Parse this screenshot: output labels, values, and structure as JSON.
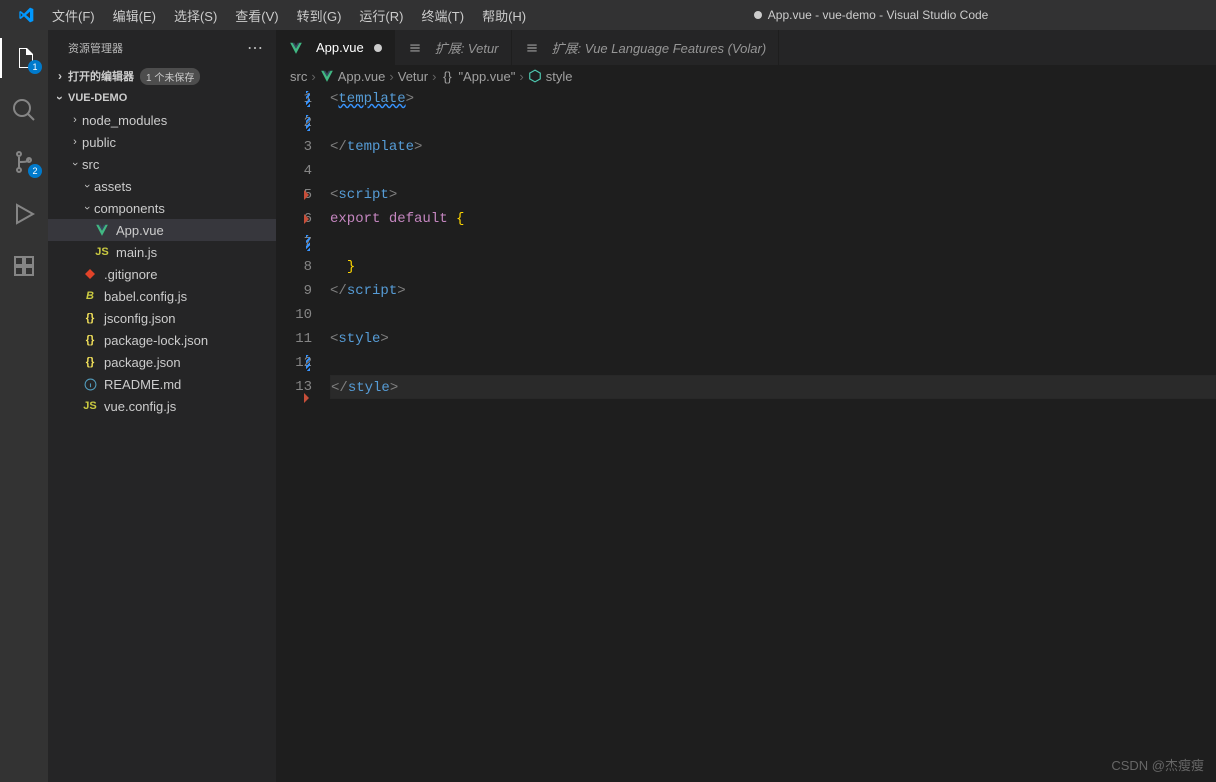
{
  "menubar": {
    "file": "文件(F)",
    "edit": "编辑(E)",
    "selection": "选择(S)",
    "view": "查看(V)",
    "go": "转到(G)",
    "run": "运行(R)",
    "terminal": "终端(T)",
    "help": "帮助(H)"
  },
  "window_title": "App.vue - vue-demo - Visual Studio Code",
  "activity_badges": {
    "explorer": "1",
    "scm": "2"
  },
  "sidebar": {
    "title": "资源管理器",
    "open_editors": {
      "label": "打开的编辑器",
      "unsaved_badge": "1 个未保存"
    },
    "root": "VUE-DEMO",
    "tree": [
      {
        "name": "node_modules",
        "type": "folder",
        "indent": 1,
        "icon": "folder",
        "expanded": false
      },
      {
        "name": "public",
        "type": "folder",
        "indent": 1,
        "icon": "folder",
        "expanded": false
      },
      {
        "name": "src",
        "type": "folder",
        "indent": 1,
        "icon": "folder",
        "expanded": true
      },
      {
        "name": "assets",
        "type": "folder",
        "indent": 2,
        "icon": "folder",
        "expanded": true
      },
      {
        "name": "components",
        "type": "folder",
        "indent": 2,
        "icon": "folder",
        "expanded": true
      },
      {
        "name": "App.vue",
        "type": "file",
        "indent": 2,
        "icon": "vue",
        "active": true
      },
      {
        "name": "main.js",
        "type": "file",
        "indent": 2,
        "icon": "js"
      },
      {
        "name": ".gitignore",
        "type": "file",
        "indent": 1,
        "icon": "git"
      },
      {
        "name": "babel.config.js",
        "type": "file",
        "indent": 1,
        "icon": "babel"
      },
      {
        "name": "jsconfig.json",
        "type": "file",
        "indent": 1,
        "icon": "json"
      },
      {
        "name": "package-lock.json",
        "type": "file",
        "indent": 1,
        "icon": "json"
      },
      {
        "name": "package.json",
        "type": "file",
        "indent": 1,
        "icon": "json"
      },
      {
        "name": "README.md",
        "type": "file",
        "indent": 1,
        "icon": "info"
      },
      {
        "name": "vue.config.js",
        "type": "file",
        "indent": 1,
        "icon": "js"
      }
    ]
  },
  "tabs": [
    {
      "label": "App.vue",
      "icon": "vue",
      "dirty": true,
      "active": true
    },
    {
      "label": "扩展: Vetur",
      "icon": "ext",
      "dirty": false,
      "active": false
    },
    {
      "label": "扩展: Vue Language Features (Volar)",
      "icon": "ext",
      "dirty": false,
      "active": false
    }
  ],
  "breadcrumbs": {
    "c0": "src",
    "c1": "App.vue",
    "c2": "Vetur",
    "c3": "\"App.vue\"",
    "c4": "style"
  },
  "code": {
    "lines": [
      {
        "n": 1,
        "html": "<span class='c-bracket'>&lt;</span><span class='c-tag c-template'>template</span><span class='c-bracket'>&gt;</span>",
        "mark": "blue"
      },
      {
        "n": 2,
        "html": "",
        "mark": "blue"
      },
      {
        "n": 3,
        "html": "<span class='c-bracket'>&lt;/</span><span class='c-tag'>template</span><span class='c-bracket'>&gt;</span>"
      },
      {
        "n": 4,
        "html": ""
      },
      {
        "n": 5,
        "html": "<span class='c-bracket'>&lt;</span><span class='c-tag'>script</span><span class='c-bracket'>&gt;</span>",
        "mark": "red"
      },
      {
        "n": 6,
        "html": "<span class='c-export'>export</span> <span class='c-export'>default</span> <span class='c-brace'>{</span>",
        "mark": "red"
      },
      {
        "n": 7,
        "html": "",
        "mark": "blue"
      },
      {
        "n": 8,
        "html": "  <span class='c-brace'>}</span>"
      },
      {
        "n": 9,
        "html": "<span class='c-bracket'>&lt;/</span><span class='c-tag'>script</span><span class='c-bracket'>&gt;</span>"
      },
      {
        "n": 10,
        "html": ""
      },
      {
        "n": 11,
        "html": "<span class='c-bracket'>&lt;</span><span class='c-tag'>style</span><span class='c-bracket'>&gt;</span>"
      },
      {
        "n": 12,
        "html": "",
        "mark": "blue"
      },
      {
        "n": 13,
        "html": "<span class='c-bracket'>&lt;/</span><span class='c-tag'>style</span><span class='c-bracket'>&gt;</span>",
        "current": true,
        "mark": "red-below"
      }
    ]
  },
  "watermark": "CSDN @杰瘦瘦"
}
